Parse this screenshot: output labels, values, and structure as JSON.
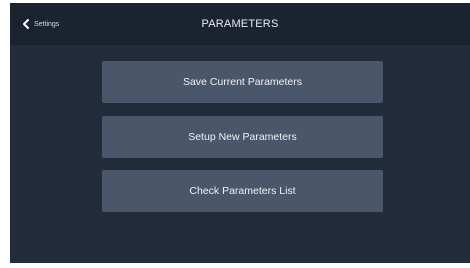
{
  "header": {
    "back_label": "Settings",
    "back_icon": "chevron-left-icon",
    "title": "PARAMETERS"
  },
  "menu": {
    "save_label": "Save Current Parameters",
    "setup_label": "Setup New Parameters",
    "check_label": "Check Parameters List"
  },
  "colors": {
    "background": "#232c3a",
    "topbar": "#1b2330",
    "button": "#4a5669",
    "text": "#eef2f7"
  }
}
